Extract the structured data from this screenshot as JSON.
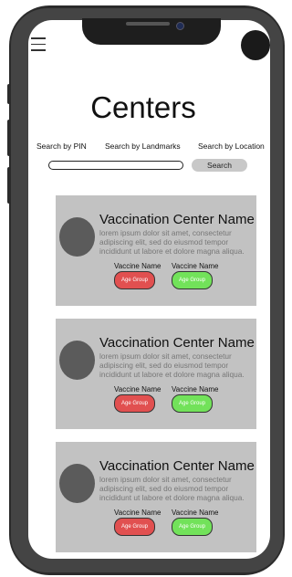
{
  "page": {
    "title": "Centers"
  },
  "tabs": [
    "Search by PIN",
    "Search by Landmarks",
    "Search by Location"
  ],
  "search": {
    "button_label": "Search",
    "input_value": ""
  },
  "centers": [
    {
      "name": "Vaccination Center Name",
      "description": "lorem ipsum dolor sit amet, consectetur adipiscing elit, sed do eiusmod tempor incididunt ut labore et dolore magna aliqua.",
      "vaccines": [
        {
          "name": "Vaccine Name",
          "group": "Age Group",
          "color": "#e15050"
        },
        {
          "name": "Vaccine Name",
          "group": "Age Group",
          "color": "#72e25a"
        }
      ]
    },
    {
      "name": "Vaccination Center Name",
      "description": "lorem ipsum dolor sit amet, consectetur adipiscing elit, sed do eiusmod tempor incididunt ut labore et dolore magna aliqua.",
      "vaccines": [
        {
          "name": "Vaccine Name",
          "group": "Age Group",
          "color": "#e15050"
        },
        {
          "name": "Vaccine Name",
          "group": "Age Group",
          "color": "#72e25a"
        }
      ]
    },
    {
      "name": "Vaccination Center Name",
      "description": "lorem ipsum dolor sit amet, consectetur adipiscing elit, sed do eiusmod tempor incididunt ut labore et dolore magna aliqua.",
      "vaccines": [
        {
          "name": "Vaccine Name",
          "group": "Age Group",
          "color": "#e15050"
        },
        {
          "name": "Vaccine Name",
          "group": "Age Group",
          "color": "#72e25a"
        }
      ]
    }
  ],
  "icons": {
    "menu": "hamburger-menu-icon",
    "profile": "profile-avatar"
  }
}
